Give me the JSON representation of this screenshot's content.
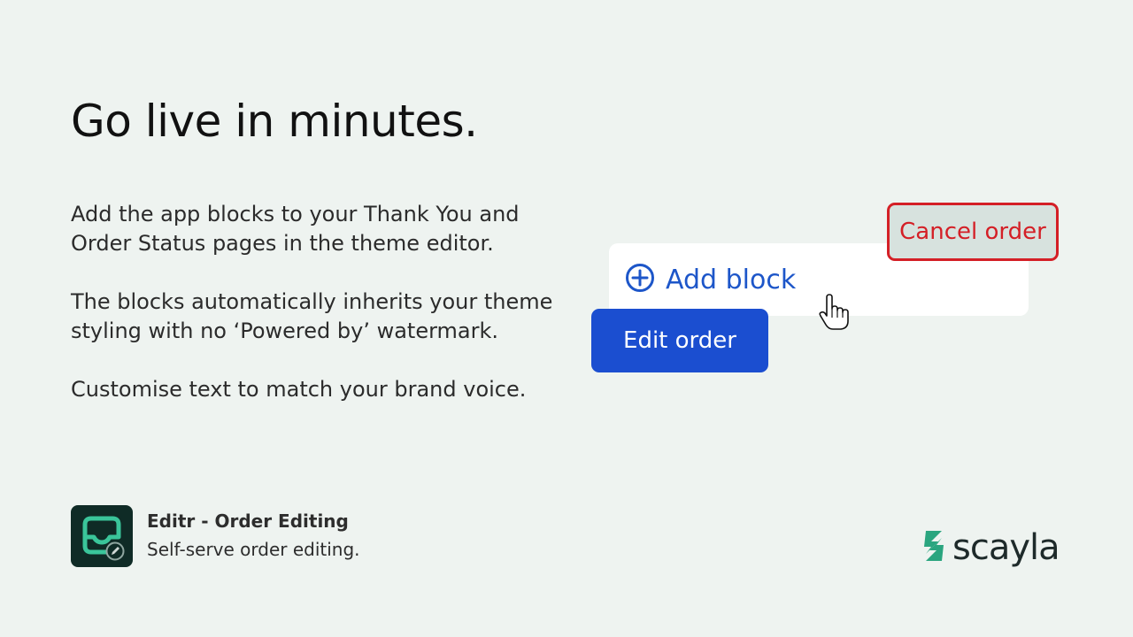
{
  "headline": "Go live in minutes.",
  "body": {
    "paragraphs": [
      "Add the app blocks to your Thank You and Order Status pages in the theme editor.",
      "The blocks automatically inherits your theme styling with no ‘Powered by’ watermark.",
      "Customise text to match your brand voice."
    ]
  },
  "app": {
    "name": "Editr - Order Editing",
    "tagline": "Self-serve order editing.",
    "icon": "inbox-edit-icon"
  },
  "illustration": {
    "add_block_label": "Add block",
    "cancel_label": "Cancel order",
    "edit_label": "Edit order"
  },
  "brand": {
    "name": "scayla"
  },
  "colors": {
    "background": "#eef3f0",
    "primary_blue": "#1b4ed0",
    "link_blue": "#1d56c9",
    "danger_red": "#d41f26",
    "brand_green": "#2aa57f",
    "app_icon_bg": "#0f2b26"
  }
}
